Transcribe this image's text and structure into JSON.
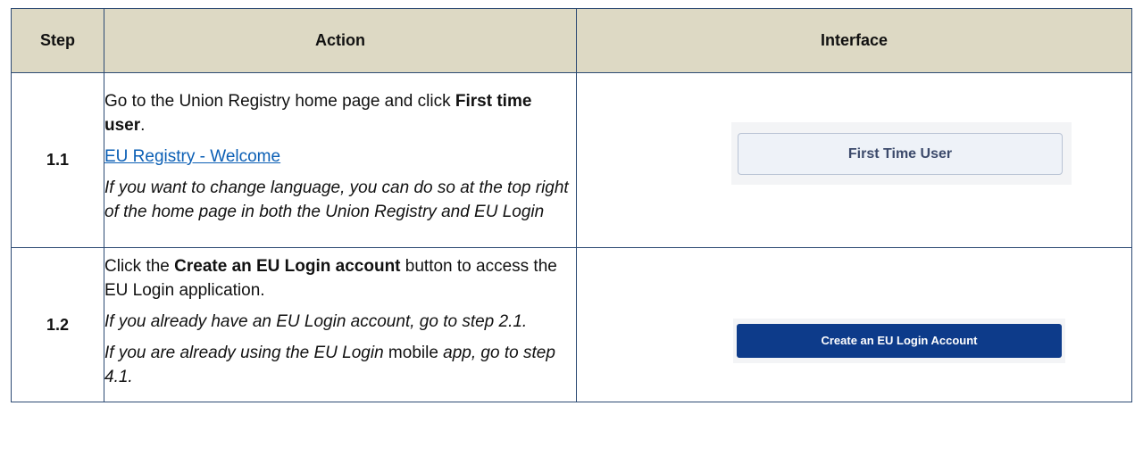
{
  "table": {
    "headers": {
      "step": "Step",
      "action": "Action",
      "interface": "Interface"
    },
    "rows": [
      {
        "step": "1.1",
        "action": {
          "line1_prefix": "Go to the Union Registry home page and click ",
          "line1_bold": "First time user",
          "line1_suffix": ".",
          "link": "EU Registry - Welcome",
          "note": "If you want to change language, you can do so at the top right of the home page in both the Union Registry and EU Login"
        },
        "interface_button": "First Time User"
      },
      {
        "step": "1.2",
        "action": {
          "line1_prefix": "Click the ",
          "line1_bold": "Create an EU Login account",
          "line1_suffix": " button to access the EU Login application.",
          "note1": "If you already have an EU Login account, go to step 2.1.",
          "note2_italic": "If you are already using the EU Login",
          "note2_plain": " mobile ",
          "note2_italic_end": "app, go to step 4.1."
        },
        "interface_button": "Create an EU Login Account"
      }
    ]
  },
  "colors": {
    "header_background": "#ddd9c4",
    "border": "#2c4a73",
    "link": "#0b5fb5",
    "primary_button": "#0d3b8a",
    "secondary_button": "#eef2f8"
  }
}
